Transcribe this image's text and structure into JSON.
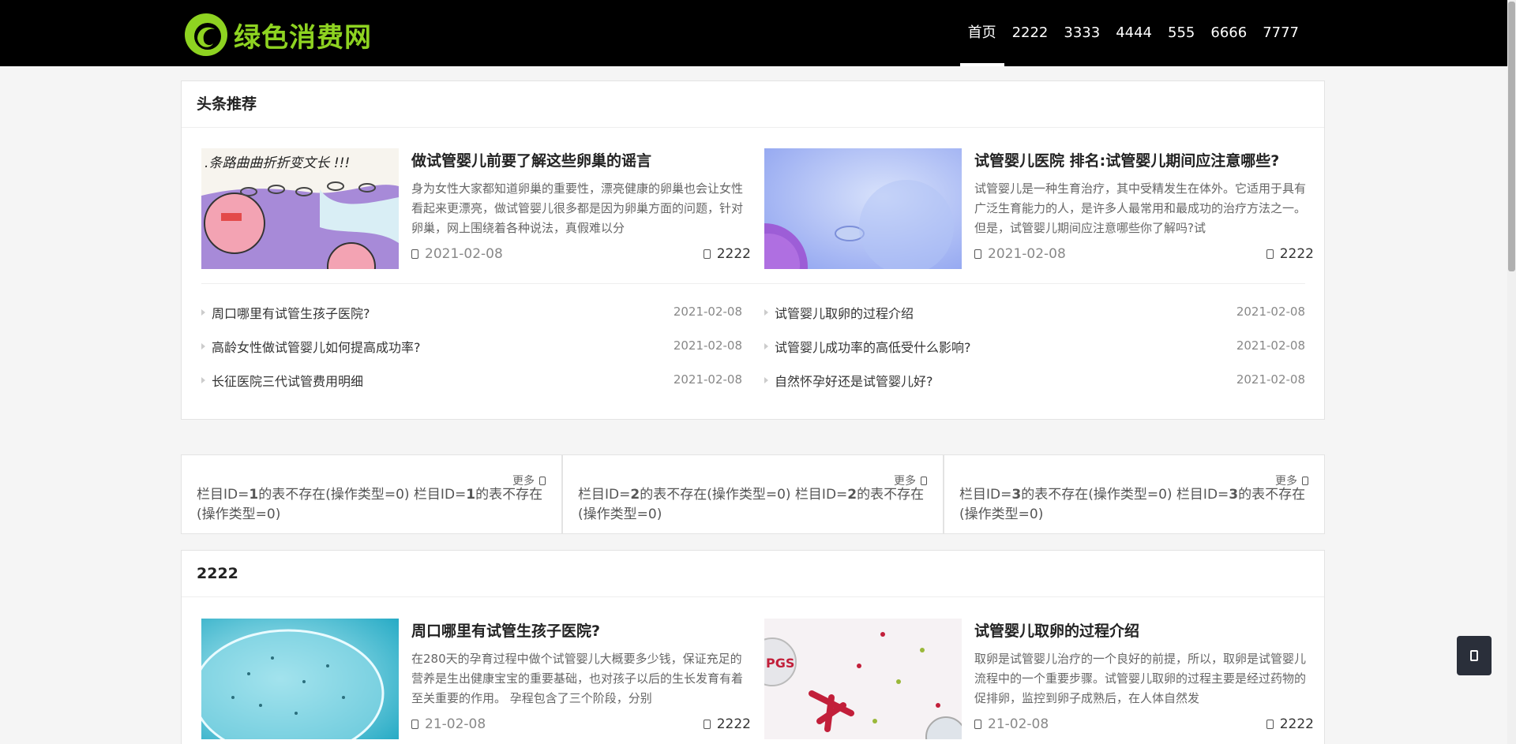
{
  "site": {
    "logo_text": "绿色消费网",
    "brand_color": "#8ed321"
  },
  "nav": [
    {
      "label": "首页",
      "active": true
    },
    {
      "label": "2222"
    },
    {
      "label": "3333"
    },
    {
      "label": "4444"
    },
    {
      "label": "555"
    },
    {
      "label": "6666"
    },
    {
      "label": "7777"
    }
  ],
  "headline": {
    "title": "头条推荐",
    "featured": [
      {
        "title": "做试管婴儿前要了解这些卵巢的谣言",
        "desc": "身为女性大家都知道卵巢的重要性，漂亮健康的卵巢也会让女性看起来更漂亮，做试管婴儿很多都是因为卵巢方面的问题，针对卵巢，网上围绕着各种说法，真假难以分",
        "date": "2021-02-08",
        "views": "2222",
        "image": "cartoon-ovary"
      },
      {
        "title": "试管婴儿医院 排名:试管婴儿期间应注意哪些?",
        "desc": "试管婴儿是一种生育治疗，其中受精发生在体外。它适用于具有广泛生育能力的人，是许多人最常用和最成功的治疗方法之一。但是，试管婴儿期间应注意哪些你了解吗?试",
        "date": "2021-02-08",
        "views": "2222",
        "image": "egg-cell"
      }
    ],
    "list_left": [
      {
        "title": "周口哪里有试管生孩子医院?",
        "date": "2021-02-08"
      },
      {
        "title": "高龄女性做试管婴儿如何提高成功率?",
        "date": "2021-02-08"
      },
      {
        "title": "长征医院三代试管费用明细",
        "date": "2021-02-08"
      }
    ],
    "list_right": [
      {
        "title": "试管婴儿取卵的过程介绍",
        "date": "2021-02-08"
      },
      {
        "title": "试管婴儿成功率的高低受什么影响?",
        "date": "2021-02-08"
      },
      {
        "title": "自然怀孕好还是试管婴儿好?",
        "date": "2021-02-08"
      }
    ]
  },
  "boxes": [
    {
      "more": "更多",
      "text_a": "栏目ID=",
      "id": "1",
      "text_b": "的表不存在(操作类型=0) 栏目ID=",
      "id2": "1",
      "text_c": "的表不存在(操作类型=0)"
    },
    {
      "more": "更多",
      "text_a": "栏目ID=",
      "id": "2",
      "text_b": "的表不存在(操作类型=0) 栏目ID=",
      "id2": "2",
      "text_c": "的表不存在(操作类型=0)"
    },
    {
      "more": "更多",
      "text_a": "栏目ID=",
      "id": "3",
      "text_b": "的表不存在(操作类型=0) 栏目ID=",
      "id2": "3",
      "text_c": "的表不存在(操作类型=0)"
    }
  ],
  "section2": {
    "title": "2222",
    "featured": [
      {
        "title": "周口哪里有试管生孩子医院?",
        "desc": "在280天的孕育过程中做个试管婴儿大概要多少钱，保证充足的营养是生出健康宝宝的重要基础，也对孩子以后的生长发育有着至关重要的作用。 孕程包含了三个阶段，分别",
        "date": "21-02-08",
        "views": "2222",
        "image": "cell-blue"
      },
      {
        "title": "试管婴儿取卵的过程介绍",
        "desc": "取卵是试管婴儿治疗的一个良好的前提，所以，取卵是试管婴儿流程中的一个重要步骤。试管婴儿取卵的过程主要是经过药物的促排卵，监控到卵子成熟后，在人体自然发",
        "date": "21-02-08",
        "views": "2222",
        "image": "pgs-chromosome",
        "image_label": "PGS"
      }
    ]
  }
}
